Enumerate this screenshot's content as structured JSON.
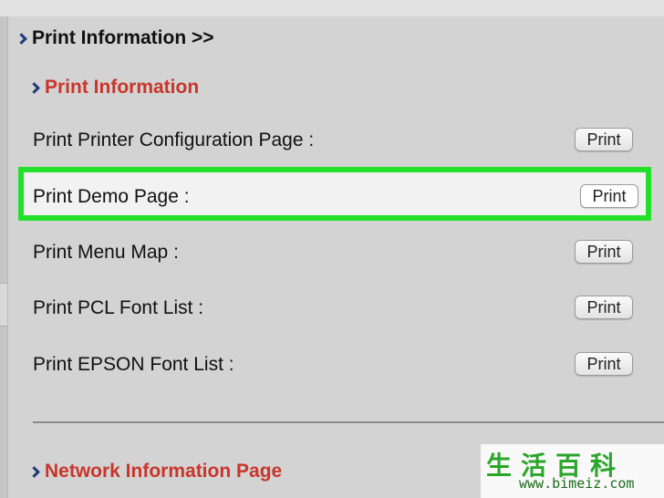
{
  "header": {
    "title": "Print Information >>"
  },
  "section": {
    "title": "Print Information"
  },
  "rows": [
    {
      "label": "Print Printer Configuration Page :",
      "button": "Print"
    },
    {
      "label": "Print Demo Page :",
      "button": "Print"
    },
    {
      "label": "Print Menu Map :",
      "button": "Print"
    },
    {
      "label": "Print PCL Font List :",
      "button": "Print"
    },
    {
      "label": "Print EPSON Font List :",
      "button": "Print"
    }
  ],
  "next_section": {
    "title": "Network Information Page"
  },
  "watermark": {
    "glyphs": "生活百科",
    "url": "www.bimeiz.com"
  },
  "colors": {
    "highlight": "#23e02b",
    "section_red": "#c9352a",
    "chevron": "#1f3a7a"
  }
}
